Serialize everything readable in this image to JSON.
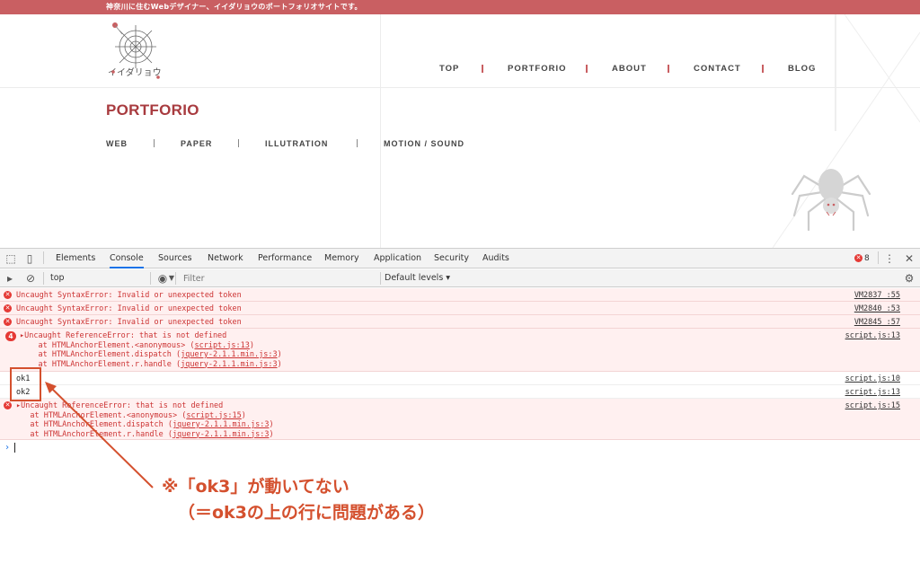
{
  "site": {
    "tagline": "神奈川に住むWebデザイナー、イイダリョウのポートフォリオサイトです。",
    "logo_text": "イイダリョウ",
    "nav": [
      "TOP",
      "PORTFORIO",
      "ABOUT",
      "CONTACT",
      "BLOG"
    ],
    "page_title": "PORTFORIO",
    "subnav": [
      "WEB",
      "PAPER",
      "ILLUTRATION",
      "MOTION / SOUND"
    ],
    "accent_color": "#c95f62"
  },
  "devtools": {
    "tabs": [
      "Elements",
      "Console",
      "Sources",
      "Network",
      "Performance",
      "Memory",
      "Application",
      "Security",
      "Audits"
    ],
    "active_tab": "Console",
    "error_count": "8",
    "context": "top",
    "filter_placeholder": "Filter",
    "levels": "Default levels",
    "messages": [
      {
        "type": "error",
        "text": "Uncaught SyntaxError: Invalid or unexpected token",
        "source": "VM2837 :55"
      },
      {
        "type": "error",
        "text": "Uncaught SyntaxError: Invalid or unexpected token",
        "source": "VM2840 :53"
      },
      {
        "type": "error",
        "text": "Uncaught SyntaxError: Invalid or unexpected token",
        "source": "VM2845 :57"
      },
      {
        "type": "error",
        "count": "4",
        "text": "Uncaught ReferenceError: that is not defined",
        "source": "script.js:13",
        "trace": [
          {
            "prefix": "    at HTMLAnchorElement.<anonymous> (",
            "link": "script.js:13",
            "suffix": ")"
          },
          {
            "prefix": "    at HTMLAnchorElement.dispatch (",
            "link": "jquery-2.1.1.min.js:3",
            "suffix": ")"
          },
          {
            "prefix": "    at HTMLAnchorElement.r.handle (",
            "link": "jquery-2.1.1.min.js:3",
            "suffix": ")"
          }
        ]
      },
      {
        "type": "log",
        "text": "ok1",
        "source": "script.js:10"
      },
      {
        "type": "log",
        "text": "ok2",
        "source": "script.js:13"
      },
      {
        "type": "error",
        "text": "Uncaught ReferenceError: that is not defined",
        "source": "script.js:15",
        "trace": [
          {
            "prefix": "   at HTMLAnchorElement.<anonymous> (",
            "link": "script.js:15",
            "suffix": ")"
          },
          {
            "prefix": "   at HTMLAnchorElement.dispatch (",
            "link": "jquery-2.1.1.min.js:3",
            "suffix": ")"
          },
          {
            "prefix": "   at HTMLAnchorElement.r.handle (",
            "link": "jquery-2.1.1.min.js:3",
            "suffix": ")"
          }
        ]
      }
    ]
  },
  "annotation": {
    "line1": "※「ok3」が動いてない",
    "line2": "（＝ok3の上の行に問題がある）",
    "color": "#d4502e"
  }
}
